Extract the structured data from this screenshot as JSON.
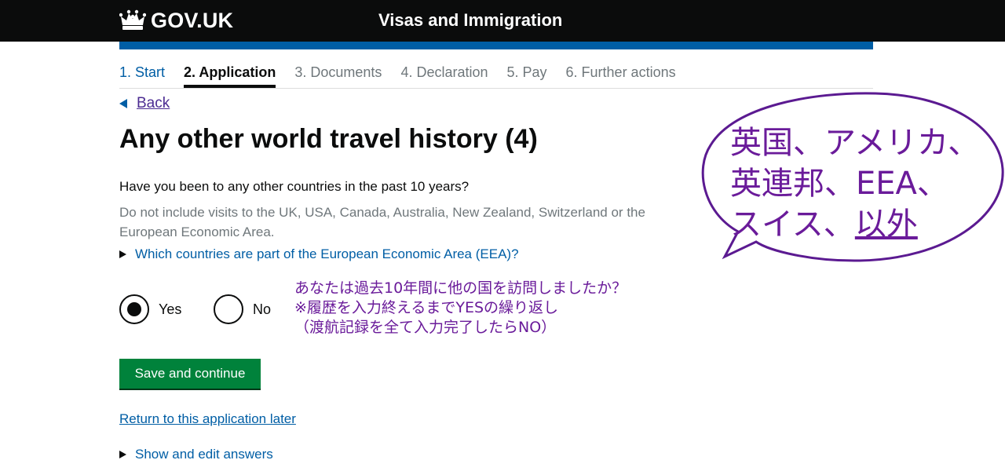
{
  "header": {
    "logo_text": "GOV.UK",
    "service_name": "Visas and Immigration"
  },
  "steps": [
    {
      "label": "1. Start",
      "state": "done"
    },
    {
      "label": "2. Application",
      "state": "current"
    },
    {
      "label": "3. Documents",
      "state": "todo"
    },
    {
      "label": "4. Declaration",
      "state": "todo"
    },
    {
      "label": "5. Pay",
      "state": "todo"
    },
    {
      "label": "6. Further actions",
      "state": "todo"
    }
  ],
  "back_label": "Back",
  "page_title": "Any other world travel history (4)",
  "question": "Have you been to any other countries in the past 10 years?",
  "hint": "Do not include visits to the UK, USA, Canada, Australia, New Zealand, Switzerland or the European Economic Area.",
  "eea_details": "Which countries are part of the European Economic Area (EEA)?",
  "radios": {
    "yes_label": "Yes",
    "no_label": "No",
    "selected": "Yes"
  },
  "save_button": "Save and continue",
  "return_link": "Return to this application later",
  "show_answers": "Show and edit answers",
  "annotation": {
    "line1": "あなたは過去10年間に他の国を訪問しましたか？",
    "line2": "※履歴を入力終えるまでYESの繰り返し",
    "line3": "（渡航記録を全て入力完了したらNO）"
  },
  "bubble": {
    "line1": "英国、アメリカ、",
    "line2": "英連邦、EEA、",
    "line3_prefix": "スイス、",
    "line3_underlined": "以外"
  },
  "colors": {
    "header_bg": "#0b0c0c",
    "blue_bar": "#005ea5",
    "link": "#005ea5",
    "visited_link": "#4c2c92",
    "button_green": "#00823b",
    "annotation_purple": "#6a1b9a"
  }
}
